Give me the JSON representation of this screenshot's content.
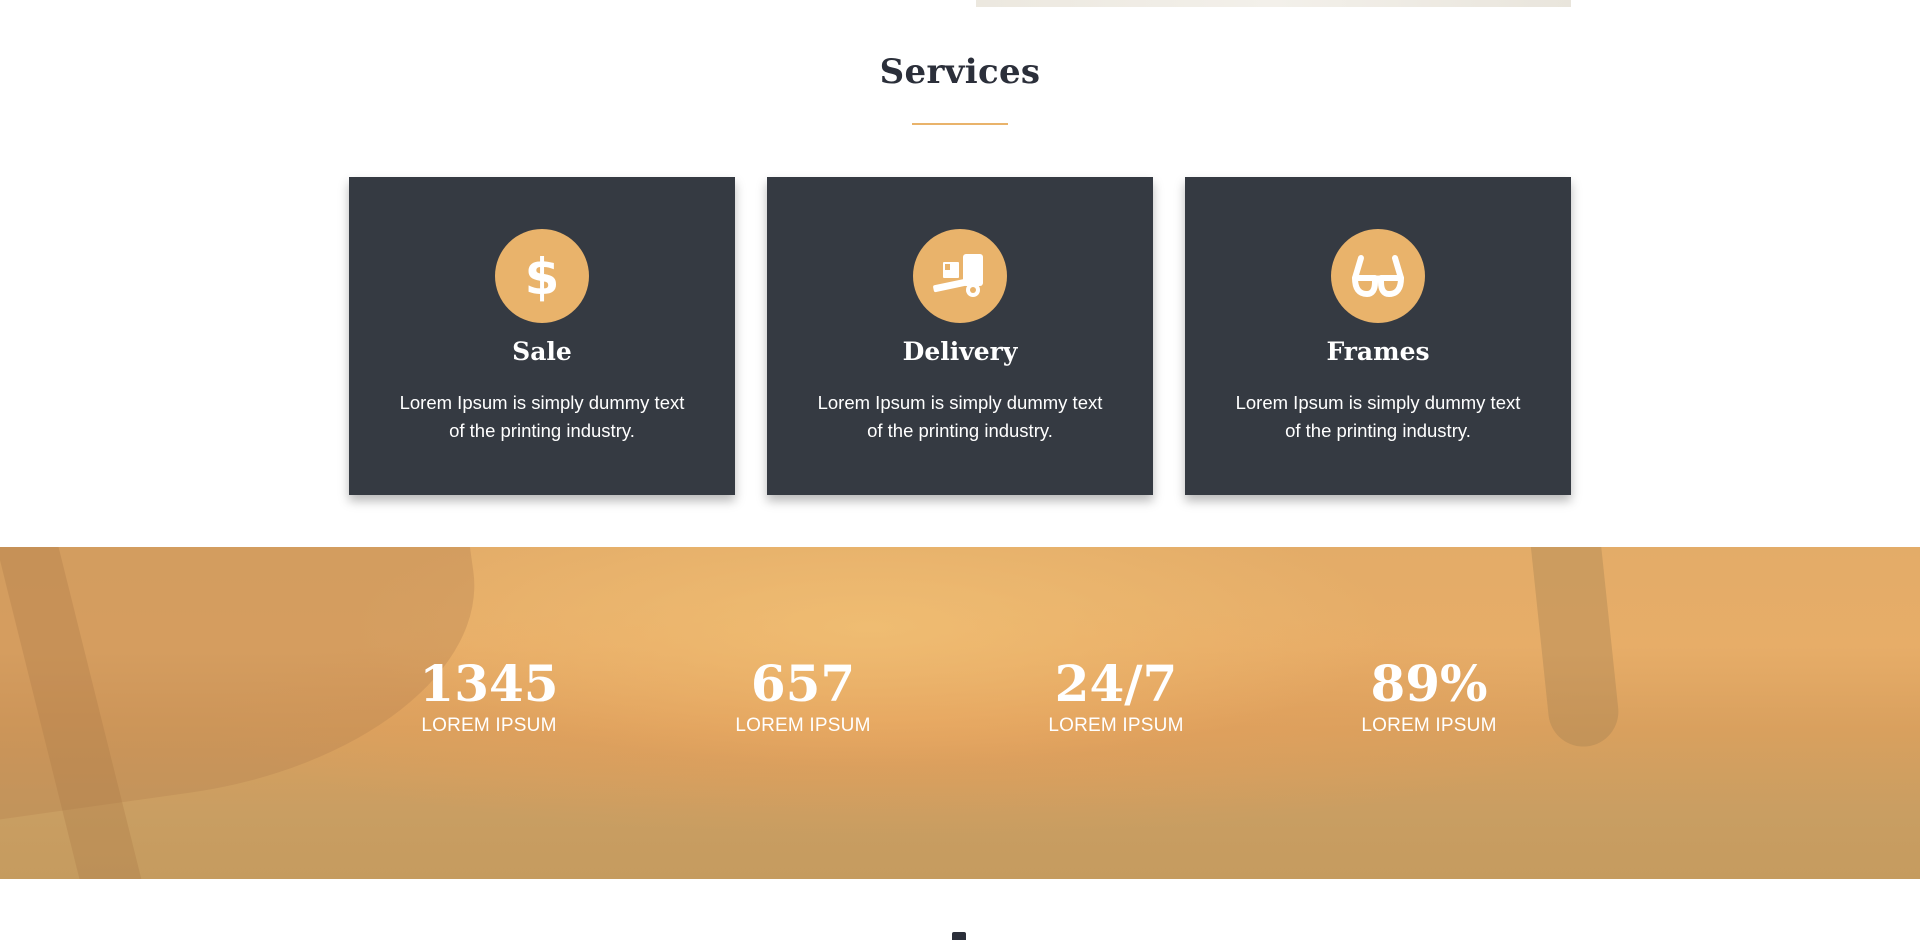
{
  "services": {
    "title": "Services",
    "items": [
      {
        "title": "Sale",
        "text": "Lorem Ipsum is simply dummy text of the printing industry.",
        "icon": "dollar-icon"
      },
      {
        "title": "Delivery",
        "text": "Lorem Ipsum is simply dummy text of the printing industry.",
        "icon": "delivery-truck-icon"
      },
      {
        "title": "Frames",
        "text": "Lorem Ipsum is simply dummy text of the printing industry.",
        "icon": "glasses-icon"
      }
    ]
  },
  "stats": [
    {
      "number": "1345",
      "label": "LOREM IPSUM"
    },
    {
      "number": "657",
      "label": "LOREM IPSUM"
    },
    {
      "number": "24/7",
      "label": "LOREM IPSUM"
    },
    {
      "number": "89%",
      "label": "LOREM IPSUM"
    }
  ],
  "colors": {
    "accent": "#e9b36b",
    "card_bg": "#353a42",
    "heading": "#2b2f3a"
  }
}
